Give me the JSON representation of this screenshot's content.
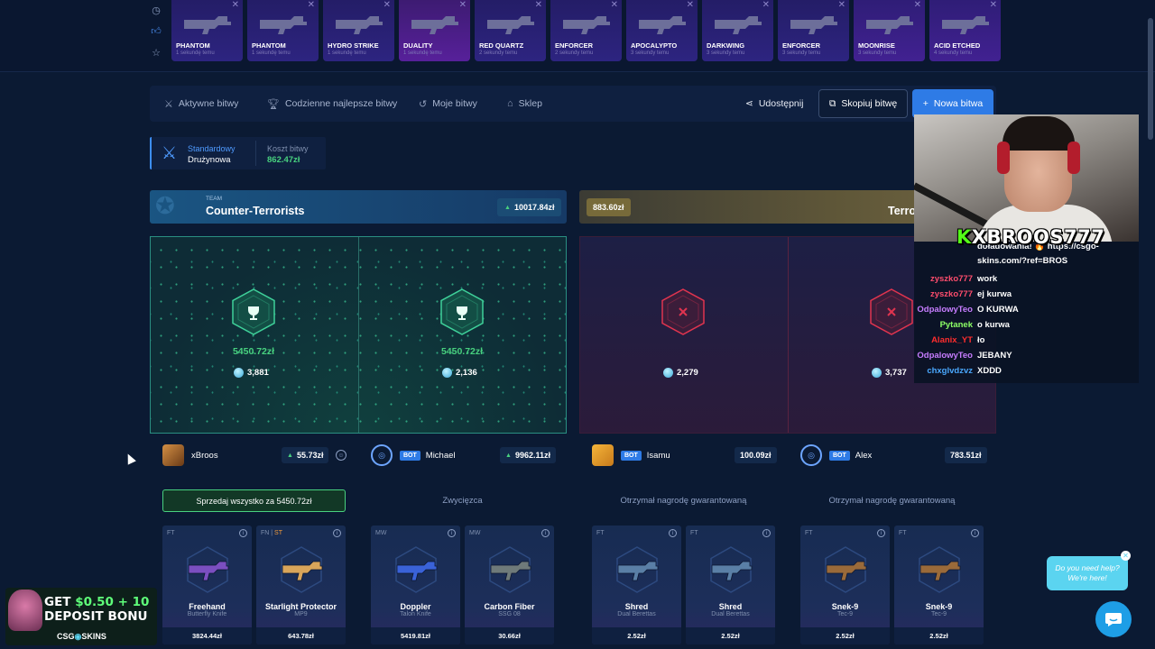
{
  "live_drops": [
    {
      "name": "PHANTOM",
      "time": "1 sekundę temu",
      "style": "blue"
    },
    {
      "name": "PHANTOM",
      "time": "1 sekundę temu",
      "style": "blue"
    },
    {
      "name": "HYDRO STRIKE",
      "time": "1 sekundę temu",
      "style": "blue"
    },
    {
      "name": "DUALITY",
      "time": "1 sekundę temu",
      "style": "pink"
    },
    {
      "name": "RED QUARTZ",
      "time": "2 sekundy temu",
      "style": "blue"
    },
    {
      "name": "ENFORCER",
      "time": "2 sekundy temu",
      "style": "blue"
    },
    {
      "name": "APOCALYPTO",
      "time": "3 sekundy temu",
      "style": "blue"
    },
    {
      "name": "DARKWING",
      "time": "3 sekundy temu",
      "style": "blue"
    },
    {
      "name": "ENFORCER",
      "time": "3 sekundy temu",
      "style": "blue"
    },
    {
      "name": "MOONRISE",
      "time": "3 sekundy temu",
      "style": "purple"
    },
    {
      "name": "ACID ETCHED",
      "time": "4 sekundy temu",
      "style": "purple"
    }
  ],
  "nav": {
    "active_battles": "Aktywne bitwy",
    "daily_best": "Codzienne najlepsze bitwy",
    "my_battles": "Moje bitwy",
    "shop": "Sklep",
    "share": "Udostępnij",
    "copy": "Skopiuj bitwę",
    "new": "Nowa bitwa"
  },
  "mode": {
    "label1": "Standardowy",
    "label2": "Drużynowa",
    "cost_label": "Koszt bitwy",
    "cost": "862.47zł"
  },
  "teams": {
    "ct": {
      "tag": "TEAM",
      "name": "Counter-Terrorists",
      "value": "10017.84zł"
    },
    "t": {
      "name": "Terro",
      "value": "883.60zł"
    }
  },
  "slots": [
    {
      "result": "win",
      "amount": "5450.72zł",
      "coins": "3,881"
    },
    {
      "result": "win",
      "amount": "5450.72zł",
      "coins": "2,136"
    },
    {
      "result": "lose",
      "coins": "2,279"
    },
    {
      "result": "lose",
      "coins": "3,737"
    }
  ],
  "players": [
    {
      "name": "xBroos",
      "bot": false,
      "value": "55.73zł",
      "up": true
    },
    {
      "name": "Michael",
      "bot": true,
      "bot_label": "BOT",
      "value": "9962.11zł",
      "up": true
    },
    {
      "name": "Isamu",
      "bot": true,
      "bot_label": "BOT",
      "value": "100.09zł",
      "up": false
    },
    {
      "name": "Alex",
      "bot": true,
      "bot_label": "BOT",
      "value": "783.51zł",
      "up": false
    }
  ],
  "sell_all": "Sprzedaj wszystko za 5450.72zł",
  "statuses": {
    "winner": "Zwycięzca",
    "guaranteed": "Otrzymał nagrodę gwarantowaną"
  },
  "items": [
    {
      "cond": "FT",
      "st": "",
      "name": "Freehand",
      "sub": "Butterfly Knife",
      "price": "3824.44zł",
      "color": "#7b4fc0"
    },
    {
      "cond": "FN | ",
      "st": "ST",
      "name": "Starlight Protector",
      "sub": "MP9",
      "price": "643.78zł",
      "color": "#d9a55a"
    },
    {
      "cond": "MW",
      "st": "",
      "name": "Doppler",
      "sub": "Talon Knife",
      "price": "5419.81zł",
      "color": "#3a62d8"
    },
    {
      "cond": "MW",
      "st": "",
      "name": "Carbon Fiber",
      "sub": "SSG 08",
      "price": "30.66zł",
      "color": "#6f7a7a"
    },
    {
      "cond": "FT",
      "st": "",
      "name": "Shred",
      "sub": "Dual Berettas",
      "price": "2.52zł",
      "color": "#5a7fa6"
    },
    {
      "cond": "FT",
      "st": "",
      "name": "Shred",
      "sub": "Dual Berettas",
      "price": "2.52zł",
      "color": "#5a7fa6"
    },
    {
      "cond": "FT",
      "st": "",
      "name": "Snek-9",
      "sub": "Tec-9",
      "price": "2.52zł",
      "color": "#9a6a3a"
    },
    {
      "cond": "FT",
      "st": "",
      "name": "Snek-9",
      "sub": "Tec-9",
      "price": "2.52zł",
      "color": "#9a6a3a"
    }
  ],
  "stream": {
    "handle_k": "K",
    "handle": "XBROOS777",
    "chat": [
      {
        "user": "",
        "msg": "doładowania! 🔥 https://csgo-",
        "color": "#ffffff"
      },
      {
        "user": "",
        "msg": "skins.com/?ref=BROS",
        "color": "#ffffff"
      },
      {
        "user": "zyszko777",
        "msg": "work",
        "color": "#ff4d6d"
      },
      {
        "user": "zyszko777",
        "msg": "ej kurwa",
        "color": "#ff4d6d"
      },
      {
        "user": "OdpalowyTeo",
        "msg": "O KURWA",
        "color": "#c77dff"
      },
      {
        "user": "Pytanek",
        "msg": "o kurwa",
        "color": "#8cff66"
      },
      {
        "user": "Alanix_YT",
        "msg": "ło",
        "color": "#ff2d2d"
      },
      {
        "user": "OdpalowyTeo",
        "msg": "JEBANY",
        "color": "#c77dff"
      },
      {
        "user": "chxglvdzvz",
        "msg": "XDDD",
        "color": "#4aa8ff"
      }
    ]
  },
  "promo": {
    "line1_a": "GET ",
    "line1_b": "$0.50 + 10",
    "line2": "DEPOSIT BONU",
    "brand": "CSG",
    "brand2": "SKINS"
  },
  "help_text_1": "Do you need help?",
  "help_text_2": "We're here!"
}
